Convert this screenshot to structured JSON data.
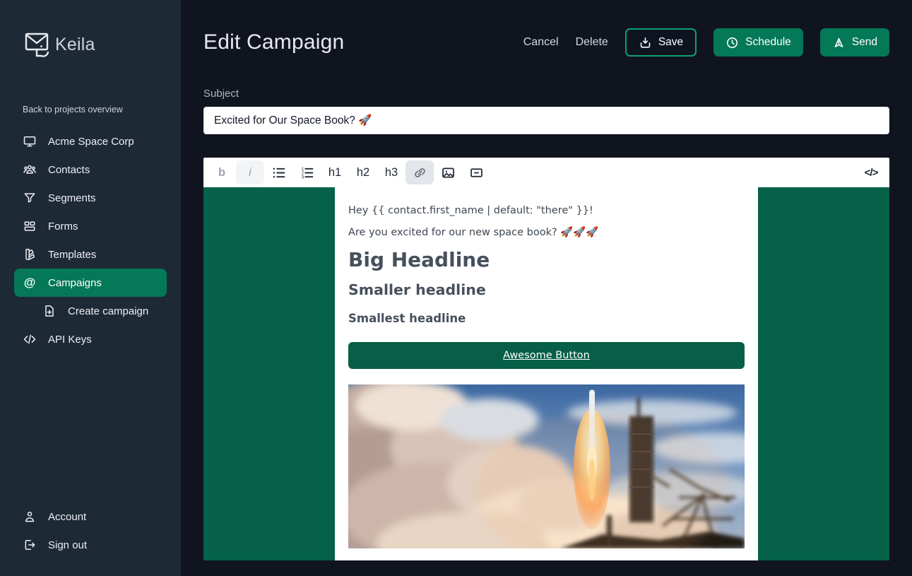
{
  "app": {
    "name": "Keila"
  },
  "sidebar": {
    "back_link": "Back to projects overview",
    "items": [
      {
        "label": "Acme Space Corp",
        "icon": "monitor-icon"
      },
      {
        "label": "Contacts",
        "icon": "users-icon"
      },
      {
        "label": "Segments",
        "icon": "funnel-icon"
      },
      {
        "label": "Forms",
        "icon": "layout-icon"
      },
      {
        "label": "Templates",
        "icon": "templates-icon"
      },
      {
        "label": "Campaigns",
        "icon": "at-sign-icon",
        "active": true
      },
      {
        "label": "Create campaign",
        "icon": "document-add-icon",
        "indent": true
      },
      {
        "label": "API Keys",
        "icon": "code-icon"
      }
    ],
    "footer_items": [
      {
        "label": "Account",
        "icon": "user-icon"
      },
      {
        "label": "Sign out",
        "icon": "sign-out-icon"
      }
    ]
  },
  "header": {
    "title": "Edit Campaign",
    "cancel_label": "Cancel",
    "delete_label": "Delete",
    "save_label": "Save",
    "schedule_label": "Schedule",
    "send_label": "Send"
  },
  "subject": {
    "label": "Subject",
    "value": "Excited for Our Space Book? 🚀"
  },
  "toolbar": {
    "bold": "b",
    "italic": "i",
    "h1": "h1",
    "h2": "h2",
    "h3": "h3",
    "code": "</>"
  },
  "email": {
    "greeting": "Hey {{ contact.first_name | default: \"there\" }}!",
    "intro": "Are you excited for our new space book? 🚀🚀🚀",
    "headline_big": "Big Headline",
    "headline_smaller": "Smaller headline",
    "headline_smallest": "Smallest headline",
    "button_label": "Awesome Button",
    "image_alt": "Rocket launching amid clouds of smoke"
  },
  "colors": {
    "sidebar_bg": "#1e2936",
    "main_bg": "#10141f",
    "accent_green": "#047857",
    "editor_green": "#056148",
    "email_button_green": "#065f46",
    "save_border_green": "#0ea06d"
  }
}
